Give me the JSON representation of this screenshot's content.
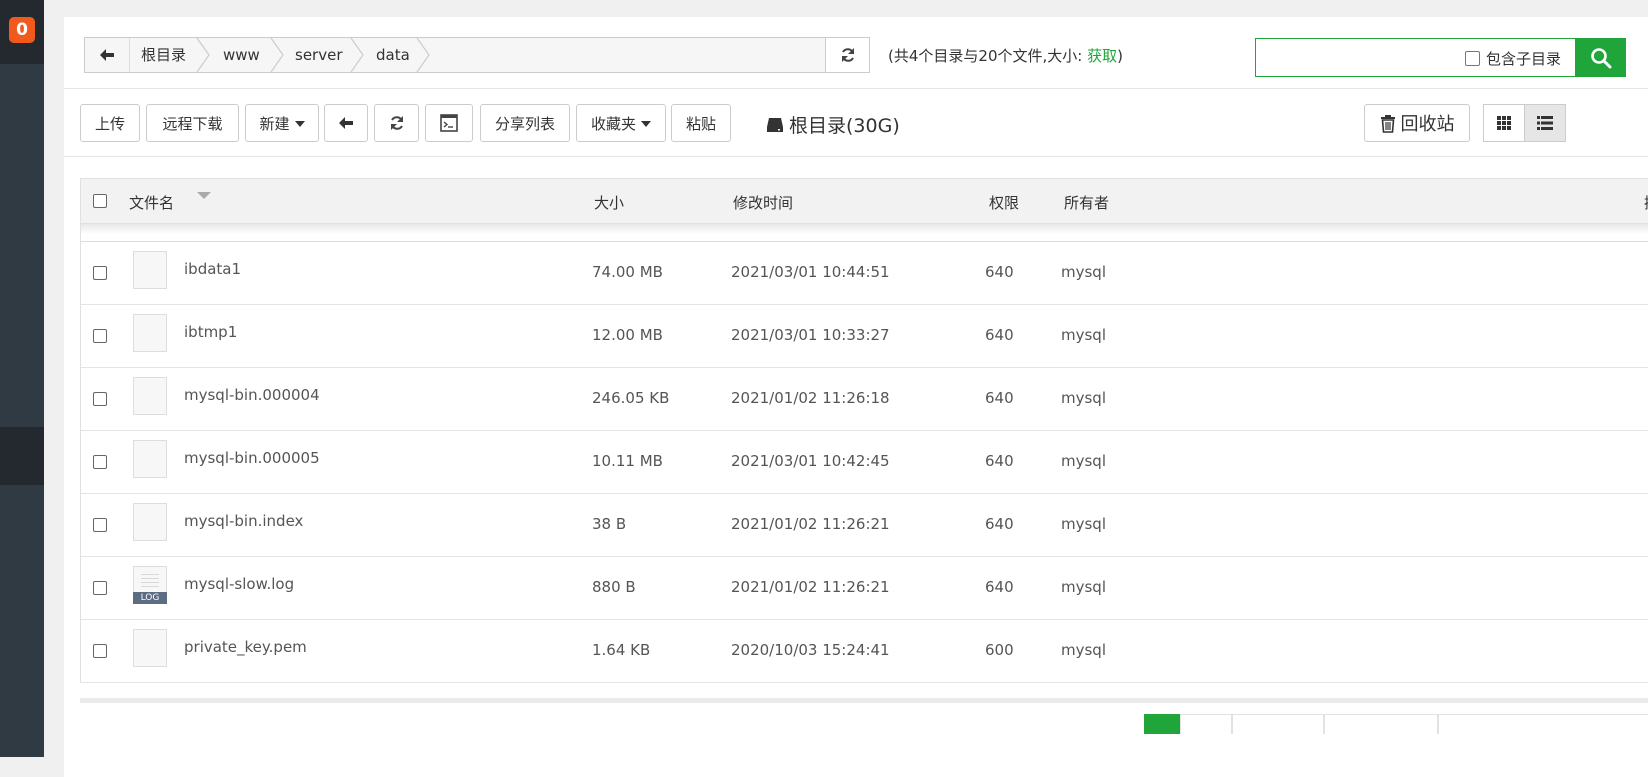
{
  "sidebar": {
    "badge": "0"
  },
  "breadcrumb": {
    "items": [
      "根目录",
      "www",
      "server",
      "data"
    ]
  },
  "summary": {
    "text": "(共4个目录与20个文件,大小: ",
    "link": "获取",
    "close": ")"
  },
  "search": {
    "placeholder": "",
    "include_sub_label": "包含子目录"
  },
  "toolbar": {
    "upload": "上传",
    "remote_download": "远程下载",
    "new": "新建",
    "share_list": "分享列表",
    "favorites": "收藏夹",
    "paste": "粘贴",
    "disk": "根目录(30G)",
    "recycle": "回收站"
  },
  "table": {
    "headers": {
      "name": "文件名",
      "size": "大小",
      "mtime": "修改时间",
      "perm": "权限",
      "owner": "所有者",
      "actions": "操作"
    },
    "rows": [
      {
        "name": "ibdata1",
        "size": "74.00 MB",
        "mtime": "2021/03/01 10:44:51",
        "perm": "640",
        "owner": "mysql",
        "icon": "file-icon"
      },
      {
        "name": "ibtmp1",
        "size": "12.00 MB",
        "mtime": "2021/03/01 10:33:27",
        "perm": "640",
        "owner": "mysql",
        "icon": "file-icon"
      },
      {
        "name": "mysql-bin.000004",
        "size": "246.05 KB",
        "mtime": "2021/01/02 11:26:18",
        "perm": "640",
        "owner": "mysql",
        "icon": "file-icon"
      },
      {
        "name": "mysql-bin.000005",
        "size": "10.11 MB",
        "mtime": "2021/03/01 10:42:45",
        "perm": "640",
        "owner": "mysql",
        "icon": "file-icon"
      },
      {
        "name": "mysql-bin.index",
        "size": "38 B",
        "mtime": "2021/01/02 11:26:21",
        "perm": "640",
        "owner": "mysql",
        "icon": "file-icon"
      },
      {
        "name": "mysql-slow.log",
        "size": "880 B",
        "mtime": "2021/01/02 11:26:21",
        "perm": "640",
        "owner": "mysql",
        "icon": "log-file-icon",
        "icon_label": "LOG"
      },
      {
        "name": "private_key.pem",
        "size": "1.64 KB",
        "mtime": "2020/10/03 15:24:41",
        "perm": "600",
        "owner": "mysql",
        "icon": "file-icon"
      }
    ]
  },
  "colors": {
    "accent": "#20a53a",
    "sidebar": "#2f3a42",
    "badge": "#f25a1d"
  }
}
